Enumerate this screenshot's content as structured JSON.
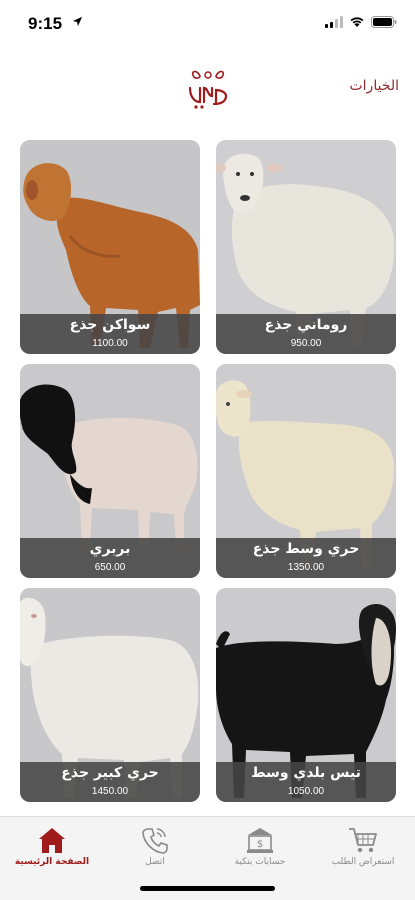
{
  "status_bar": {
    "time": "9:15"
  },
  "header": {
    "options_label": "الخيارات",
    "logo_text": "الجابري"
  },
  "products": [
    {
      "name": "سواكن جذع",
      "price": "1100.00",
      "animal": "brown-goat"
    },
    {
      "name": "روماني جذع",
      "price": "950.00",
      "animal": "white-sheep"
    },
    {
      "name": "بربري",
      "price": "650.00",
      "animal": "black-headed-sheep"
    },
    {
      "name": "حري وسط جذع",
      "price": "1350.00",
      "animal": "cream-sheep"
    },
    {
      "name": "حري كبير جذع",
      "price": "1450.00",
      "animal": "white-sheep-large"
    },
    {
      "name": "تيس بلدي وسط",
      "price": "1050.00",
      "animal": "black-goat"
    }
  ],
  "tabbar": {
    "home": "الصفحة الرئيسية",
    "contact": "اتصل",
    "bank": "حسابات بنكية",
    "orders": "استعراض الطلب"
  },
  "colors": {
    "accent": "#a01c1c",
    "caption_bg": "#464646",
    "card_bg": "#c9c9ca"
  }
}
